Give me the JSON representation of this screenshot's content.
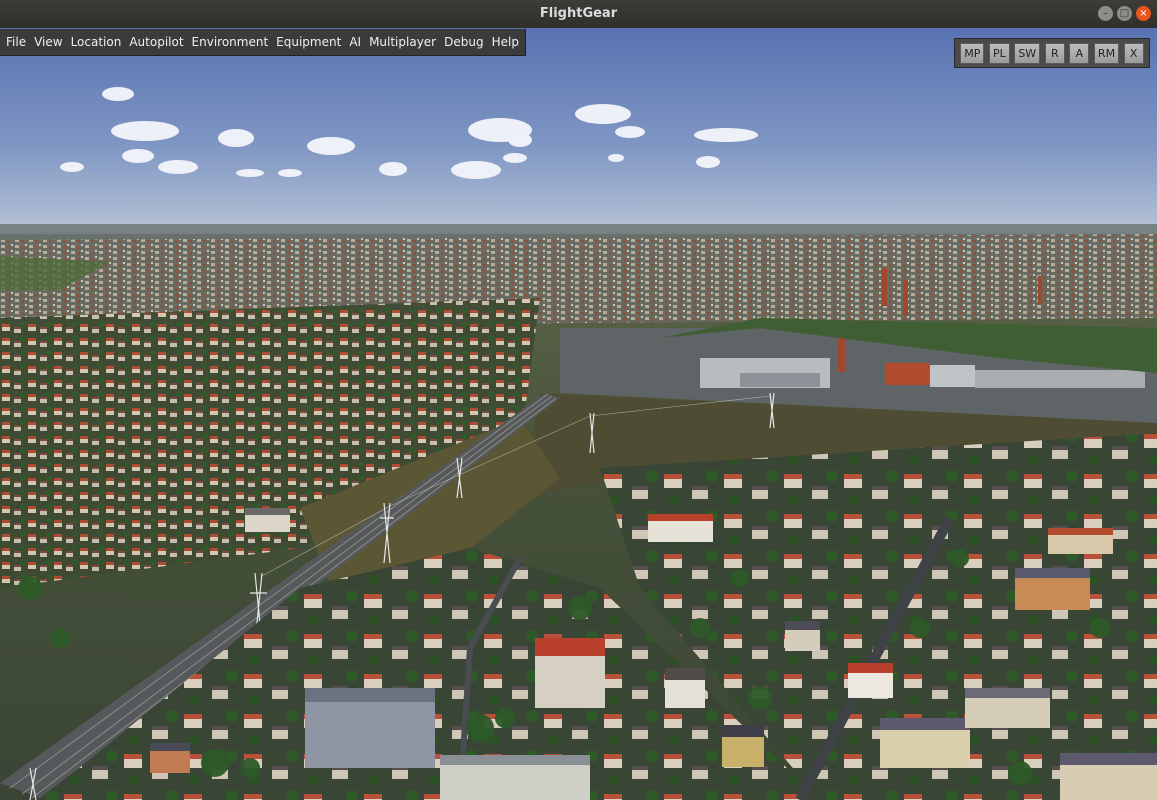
{
  "window": {
    "title": "FlightGear"
  },
  "menu": [
    "File",
    "View",
    "Location",
    "Autopilot",
    "Environment",
    "Equipment",
    "AI",
    "Multiplayer",
    "Debug",
    "Help"
  ],
  "quickbar": [
    "MP",
    "PL",
    "SW",
    "R",
    "A",
    "RM",
    "X"
  ],
  "colors": {
    "sky_top": "#5b77b4",
    "sky_horizon": "#aebbd0",
    "ground": "#4b5a3a",
    "roofs": "#b7472e"
  },
  "icons": {
    "minimize": "minimize-icon",
    "maximize": "maximize-icon",
    "close": "close-icon"
  }
}
